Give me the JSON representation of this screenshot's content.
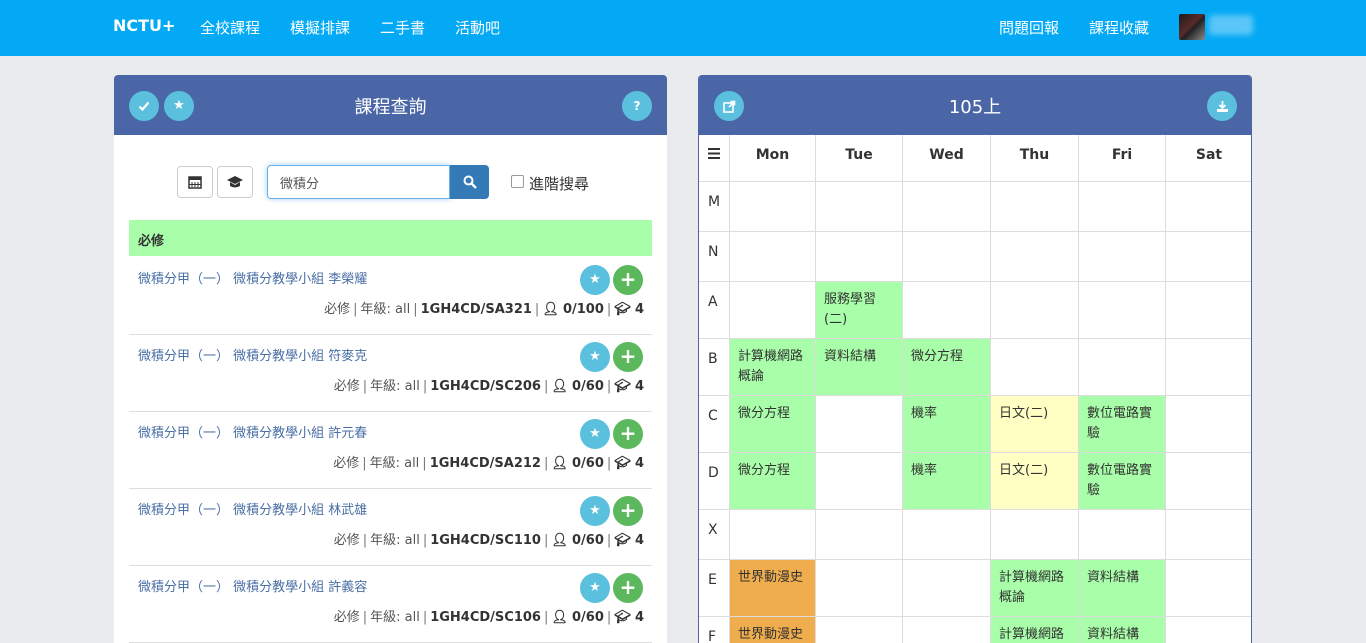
{
  "nav": {
    "brand": "NCTU+",
    "links": [
      "全校課程",
      "模擬排課",
      "二手書",
      "活動吧"
    ],
    "right_links": [
      "問題回報",
      "課程收藏"
    ]
  },
  "search_panel": {
    "title": "課程查詢",
    "help_label": "?",
    "search_value": "微積分",
    "advanced_label": "進階搜尋",
    "section_label": "必修",
    "courses": [
      {
        "name": "微積分甲（一） 微積分教學小組 李榮耀",
        "type": "必修",
        "grade_label": "年級: all",
        "code": "1GH4CD/SA321",
        "enroll": "0/100",
        "credits": "4"
      },
      {
        "name": "微積分甲（一） 微積分教學小組 符麥克",
        "type": "必修",
        "grade_label": "年級: all",
        "code": "1GH4CD/SC206",
        "enroll": "0/60",
        "credits": "4"
      },
      {
        "name": "微積分甲（一） 微積分教學小組 許元春",
        "type": "必修",
        "grade_label": "年級: all",
        "code": "1GH4CD/SA212",
        "enroll": "0/60",
        "credits": "4"
      },
      {
        "name": "微積分甲（一） 微積分教學小組 林武雄",
        "type": "必修",
        "grade_label": "年級: all",
        "code": "1GH4CD/SC110",
        "enroll": "0/60",
        "credits": "4"
      },
      {
        "name": "微積分甲（一） 微積分教學小組 許義容",
        "type": "必修",
        "grade_label": "年級: all",
        "code": "1GH4CD/SC106",
        "enroll": "0/60",
        "credits": "4"
      }
    ]
  },
  "schedule_panel": {
    "title": "105上",
    "days": [
      "Mon",
      "Tue",
      "Wed",
      "Thu",
      "Fri",
      "Sat"
    ],
    "slots": [
      "M",
      "N",
      "A",
      "B",
      "C",
      "D",
      "X",
      "E",
      "F"
    ],
    "cells": {
      "A": [
        "",
        "服務學習(二)",
        "",
        "",
        "",
        ""
      ],
      "B": [
        "計算機網路概論",
        "資料結構",
        "微分方程",
        "",
        "",
        ""
      ],
      "C": [
        "微分方程",
        "",
        "機率",
        "日文(二)",
        "數位電路實驗",
        ""
      ],
      "D": [
        "微分方程",
        "",
        "機率",
        "日文(二)",
        "數位電路實驗",
        ""
      ],
      "E": [
        "世界動漫史",
        "",
        "",
        "計算機網路概論",
        "資料結構",
        ""
      ],
      "F": [
        "世界動漫史",
        "",
        "",
        "計算機網路概論",
        "資料結構",
        ""
      ]
    },
    "colors": {
      "required": "#a9ffa9",
      "language": "#ffffc4",
      "general": "#f0ad4e"
    }
  }
}
